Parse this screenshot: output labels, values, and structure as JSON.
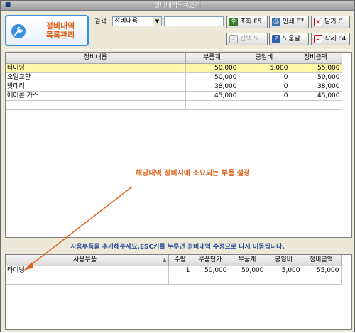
{
  "window": {
    "title": "정비내역목록관리"
  },
  "logo": {
    "line1": "정비내역",
    "line2": "목록관리"
  },
  "search": {
    "label": "검색 :",
    "selected": "정비내용",
    "value": ""
  },
  "toolbar": {
    "search_button": "조회 F5",
    "print_button": "인쇄 F7",
    "close_button": "닫기 C",
    "select_button": "선택 S",
    "help_button": "도움말",
    "delete_button": "삭제 F4"
  },
  "items_table": {
    "columns": [
      "정비내용",
      "부품계",
      "공임비",
      "정비금액"
    ],
    "rows": [
      [
        "타이닝",
        "50,000",
        "5,000",
        "55,000"
      ],
      [
        "오일교환",
        "50,000",
        "0",
        "50,000"
      ],
      [
        "밧데리",
        "38,000",
        "0",
        "38,000"
      ],
      [
        "에어콘 가스",
        "45,000",
        "0",
        "45,000"
      ]
    ]
  },
  "annotation": {
    "text": "해당내역 정비시에 소요되는 부품 설정"
  },
  "instruction": {
    "text": "사용부품을 추가해주세요.ESC키를 누루면 정비내역 수정으로 다시 이동됩니다."
  },
  "parts_table": {
    "columns": [
      "사용부품",
      "수량",
      "부품단가",
      "부품계",
      "공임비",
      "정비금액"
    ],
    "rows": [
      [
        "타이닝",
        "1",
        "50,000",
        "50,000",
        "5,000",
        "55,000"
      ]
    ]
  },
  "colors": {
    "accent_orange": "#e0621a",
    "selected_row": "#fff6a8",
    "instruction_blue": "#2c4c9c"
  }
}
